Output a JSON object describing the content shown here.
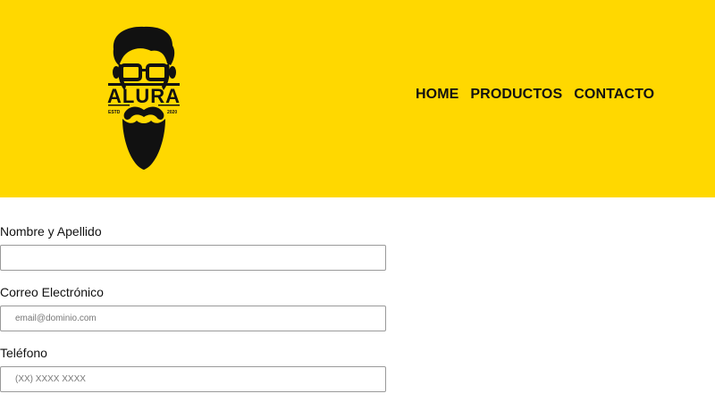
{
  "header": {
    "logo": {
      "brand": "ALURA",
      "estd": "ESTD",
      "year": "2020",
      "icon": "bearded-man-with-glasses-logo"
    },
    "nav": [
      "HOME",
      "PRODUCTOS",
      "CONTACTO"
    ]
  },
  "form": {
    "name": {
      "label": "Nombre y Apellido",
      "value": "",
      "placeholder": ""
    },
    "email": {
      "label": "Correo Electrónico",
      "value": "",
      "placeholder": "email@dominio.com"
    },
    "phone": {
      "label": "Teléfono",
      "value": "",
      "placeholder": "(XX) XXXX XXXX"
    }
  },
  "colors": {
    "header_bg": "#ffd800",
    "text": "#111111",
    "input_border": "#9a9a9a"
  }
}
